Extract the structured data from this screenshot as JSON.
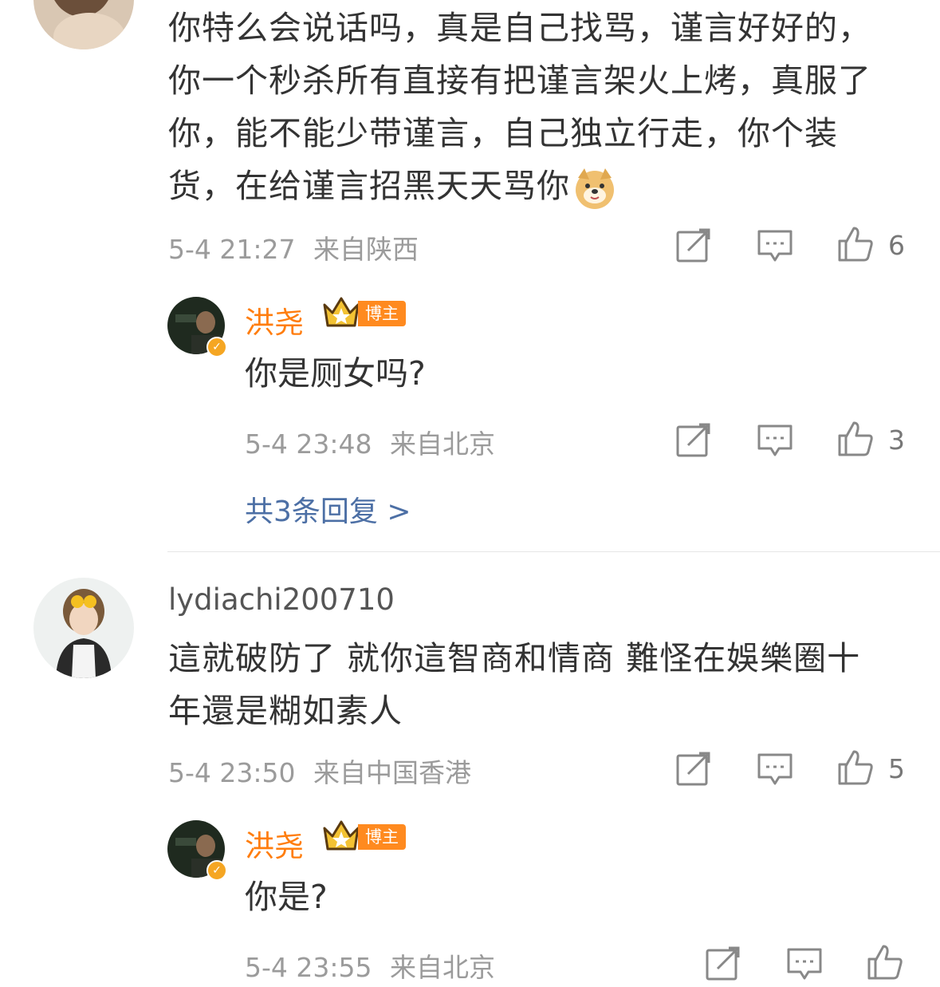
{
  "comments": [
    {
      "text": "你特么会说话吗，真是自己找骂，谨言好好的，你一个秒杀所有直接有把谨言架火上烤，真服了你，能不能少带谨言，自己独立行走，你个装货，在给谨言招黑天天骂你",
      "emoji": "doge-emoji",
      "time": "5-4 21:27",
      "location": "来自陕西",
      "likes": "6",
      "reply": {
        "username": "洪尧",
        "badge": "博主",
        "text": "你是厕女吗?",
        "time": "5-4 23:48",
        "location": "来自北京",
        "likes": "3"
      },
      "more_replies": "共3条回复 >"
    },
    {
      "username": "lydiachi200710",
      "text": "這就破防了 就你這智商和情商 難怪在娛樂圈十年還是糊如素人",
      "time": "5-4 23:50",
      "location": "来自中国香港",
      "likes": "5",
      "reply": {
        "username": "洪尧",
        "badge": "博主",
        "text": "你是?",
        "time": "5-4 23:55",
        "location": "来自北京",
        "likes": ""
      }
    }
  ],
  "colors": {
    "username_accent": "#ff7d0d",
    "link": "#4c6fa5",
    "meta": "#9b9b9b"
  }
}
